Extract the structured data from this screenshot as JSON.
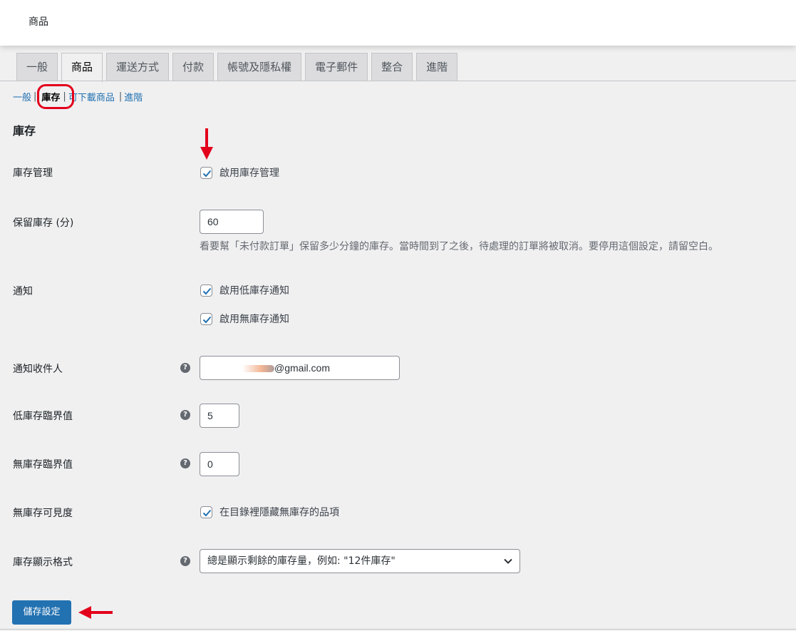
{
  "page": {
    "title": "商品"
  },
  "tabs": [
    {
      "label": "一般"
    },
    {
      "label": "商品"
    },
    {
      "label": "運送方式"
    },
    {
      "label": "付款"
    },
    {
      "label": "帳號及隱私權"
    },
    {
      "label": "電子郵件"
    },
    {
      "label": "整合"
    },
    {
      "label": "進階"
    }
  ],
  "subsections": [
    {
      "label": "一般"
    },
    {
      "label": "庫存"
    },
    {
      "label": "可下載商品"
    },
    {
      "label": "進階"
    }
  ],
  "section": {
    "title": "庫存"
  },
  "fields": {
    "manage_stock": {
      "label": "庫存管理",
      "checkbox_label": "啟用庫存管理",
      "checked": true
    },
    "hold_stock": {
      "label": "保留庫存 (分)",
      "value": "60",
      "description": "看要幫「未付款訂單」保留多少分鐘的庫存。當時間到了之後，待處理的訂單將被取消。要停用這個設定，請留空白。"
    },
    "notifications": {
      "label": "通知",
      "low_stock_label": "啟用低庫存通知",
      "out_of_stock_label": "啟用無庫存通知"
    },
    "notification_recipient": {
      "label": "通知收件人",
      "value": "@gmail.com"
    },
    "low_stock_threshold": {
      "label": "低庫存臨界值",
      "value": "5"
    },
    "out_of_stock_threshold": {
      "label": "無庫存臨界值",
      "value": "0"
    },
    "out_of_stock_visibility": {
      "label": "無庫存可見度",
      "checkbox_label": "在目錄裡隱藏無庫存的品項"
    },
    "stock_display_format": {
      "label": "庫存顯示格式",
      "selected": "總是顯示剩餘的庫存量，例如: \"12件庫存\""
    }
  },
  "save_button": {
    "label": "儲存設定"
  },
  "colors": {
    "accent": "#2271b1",
    "annotation": "#e3001b",
    "background": "#f0f0f1"
  },
  "icons": [
    "checkmark-icon",
    "help-icon",
    "chevron-down-icon",
    "arrow-down-icon",
    "arrow-left-icon"
  ]
}
